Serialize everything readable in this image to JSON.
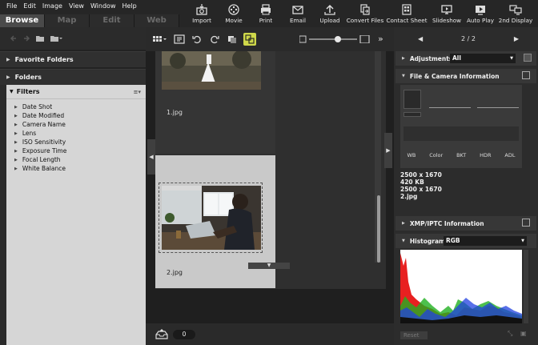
{
  "menu": [
    "File",
    "Edit",
    "Image",
    "View",
    "Window",
    "Help"
  ],
  "modes": [
    {
      "label": "Browse",
      "active": true
    },
    {
      "label": "Map",
      "active": false
    },
    {
      "label": "Edit",
      "active": false
    },
    {
      "label": "Web",
      "active": false
    }
  ],
  "toolbar": [
    {
      "label": "Import",
      "icon": "import-icon"
    },
    {
      "label": "Movie",
      "icon": "movie-icon"
    },
    {
      "label": "Print",
      "icon": "print-icon"
    },
    {
      "label": "Email",
      "icon": "email-icon"
    },
    {
      "label": "Upload",
      "icon": "upload-icon"
    },
    {
      "label": "Convert Files",
      "icon": "convert-files-icon"
    },
    {
      "label": "Contact Sheet",
      "icon": "contact-sheet-icon"
    },
    {
      "label": "Slideshow",
      "icon": "slideshow-icon"
    },
    {
      "label": "Auto Play",
      "icon": "auto-play-icon"
    },
    {
      "label": "2nd Display",
      "icon": "second-display-icon"
    }
  ],
  "left": {
    "favorite_folders": "Favorite Folders",
    "folders": "Folders",
    "filters": "Filters",
    "filter_items": [
      "Date Shot",
      "Date Modified",
      "Camera Name",
      "Lens",
      "ISO Sensitivity",
      "Exposure Time",
      "Focal Length",
      "White Balance"
    ]
  },
  "grid": {
    "items": [
      {
        "filename": "1.jpg"
      },
      {
        "filename": "2.jpg"
      }
    ],
    "selected_count": "0"
  },
  "right": {
    "pager": "2 / 2",
    "adjustments_label": "Adjustments",
    "adjustments_value": "All",
    "file_camera_label": "File & Camera Information",
    "info_columns": [
      "WB",
      "Color",
      "BKT",
      "HDR",
      "ADL"
    ],
    "info_lines": [
      "2500 x 1670",
      "420 KB",
      "2500 x 1670",
      "2.jpg"
    ],
    "xmp_label": "XMP/IPTC Information",
    "histogram_label": "Histogram",
    "histogram_channel": "RGB",
    "reset_label": "Reset"
  },
  "colors": {
    "accent_yellow": "#cfd84a",
    "panel_light": "#d6d6d6",
    "background": "#1e1e1e"
  }
}
